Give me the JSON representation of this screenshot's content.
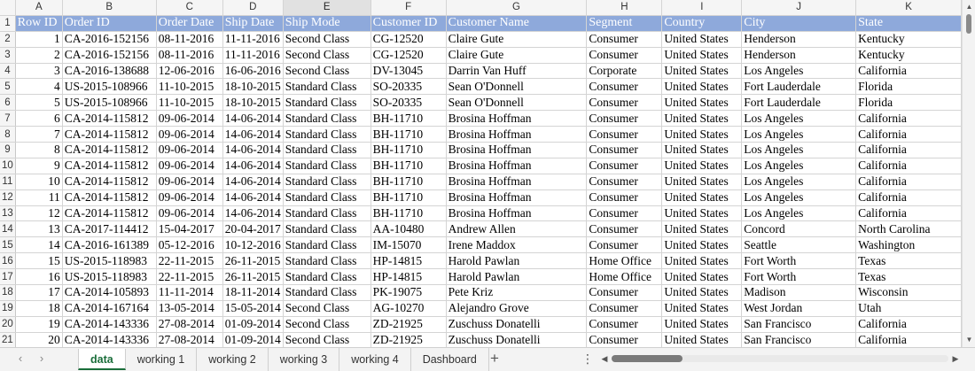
{
  "columns": [
    "A",
    "B",
    "C",
    "D",
    "E",
    "F",
    "G",
    "H",
    "I",
    "J",
    "K"
  ],
  "active_column": "E",
  "headers": [
    "Row ID",
    "Order ID",
    "Order Date",
    "Ship Date",
    "Ship Mode",
    "Customer ID",
    "Customer Name",
    "Segment",
    "Country",
    "City",
    "State"
  ],
  "rows": [
    [
      "1",
      "CA-2016-152156",
      "08-11-2016",
      "11-11-2016",
      "Second Class",
      "CG-12520",
      "Claire Gute",
      "Consumer",
      "United States",
      "Henderson",
      "Kentucky"
    ],
    [
      "2",
      "CA-2016-152156",
      "08-11-2016",
      "11-11-2016",
      "Second Class",
      "CG-12520",
      "Claire Gute",
      "Consumer",
      "United States",
      "Henderson",
      "Kentucky"
    ],
    [
      "3",
      "CA-2016-138688",
      "12-06-2016",
      "16-06-2016",
      "Second Class",
      "DV-13045",
      "Darrin Van Huff",
      "Corporate",
      "United States",
      "Los Angeles",
      "California"
    ],
    [
      "4",
      "US-2015-108966",
      "11-10-2015",
      "18-10-2015",
      "Standard Class",
      "SO-20335",
      "Sean O'Donnell",
      "Consumer",
      "United States",
      "Fort Lauderdale",
      "Florida"
    ],
    [
      "5",
      "US-2015-108966",
      "11-10-2015",
      "18-10-2015",
      "Standard Class",
      "SO-20335",
      "Sean O'Donnell",
      "Consumer",
      "United States",
      "Fort Lauderdale",
      "Florida"
    ],
    [
      "6",
      "CA-2014-115812",
      "09-06-2014",
      "14-06-2014",
      "Standard Class",
      "BH-11710",
      "Brosina Hoffman",
      "Consumer",
      "United States",
      "Los Angeles",
      "California"
    ],
    [
      "7",
      "CA-2014-115812",
      "09-06-2014",
      "14-06-2014",
      "Standard Class",
      "BH-11710",
      "Brosina Hoffman",
      "Consumer",
      "United States",
      "Los Angeles",
      "California"
    ],
    [
      "8",
      "CA-2014-115812",
      "09-06-2014",
      "14-06-2014",
      "Standard Class",
      "BH-11710",
      "Brosina Hoffman",
      "Consumer",
      "United States",
      "Los Angeles",
      "California"
    ],
    [
      "9",
      "CA-2014-115812",
      "09-06-2014",
      "14-06-2014",
      "Standard Class",
      "BH-11710",
      "Brosina Hoffman",
      "Consumer",
      "United States",
      "Los Angeles",
      "California"
    ],
    [
      "10",
      "CA-2014-115812",
      "09-06-2014",
      "14-06-2014",
      "Standard Class",
      "BH-11710",
      "Brosina Hoffman",
      "Consumer",
      "United States",
      "Los Angeles",
      "California"
    ],
    [
      "11",
      "CA-2014-115812",
      "09-06-2014",
      "14-06-2014",
      "Standard Class",
      "BH-11710",
      "Brosina Hoffman",
      "Consumer",
      "United States",
      "Los Angeles",
      "California"
    ],
    [
      "12",
      "CA-2014-115812",
      "09-06-2014",
      "14-06-2014",
      "Standard Class",
      "BH-11710",
      "Brosina Hoffman",
      "Consumer",
      "United States",
      "Los Angeles",
      "California"
    ],
    [
      "13",
      "CA-2017-114412",
      "15-04-2017",
      "20-04-2017",
      "Standard Class",
      "AA-10480",
      "Andrew Allen",
      "Consumer",
      "United States",
      "Concord",
      "North Carolina"
    ],
    [
      "14",
      "CA-2016-161389",
      "05-12-2016",
      "10-12-2016",
      "Standard Class",
      "IM-15070",
      "Irene Maddox",
      "Consumer",
      "United States",
      "Seattle",
      "Washington"
    ],
    [
      "15",
      "US-2015-118983",
      "22-11-2015",
      "26-11-2015",
      "Standard Class",
      "HP-14815",
      "Harold Pawlan",
      "Home Office",
      "United States",
      "Fort Worth",
      "Texas"
    ],
    [
      "16",
      "US-2015-118983",
      "22-11-2015",
      "26-11-2015",
      "Standard Class",
      "HP-14815",
      "Harold Pawlan",
      "Home Office",
      "United States",
      "Fort Worth",
      "Texas"
    ],
    [
      "17",
      "CA-2014-105893",
      "11-11-2014",
      "18-11-2014",
      "Standard Class",
      "PK-19075",
      "Pete Kriz",
      "Consumer",
      "United States",
      "Madison",
      "Wisconsin"
    ],
    [
      "18",
      "CA-2014-167164",
      "13-05-2014",
      "15-05-2014",
      "Second Class",
      "AG-10270",
      "Alejandro Grove",
      "Consumer",
      "United States",
      "West Jordan",
      "Utah"
    ],
    [
      "19",
      "CA-2014-143336",
      "27-08-2014",
      "01-09-2014",
      "Second Class",
      "ZD-21925",
      "Zuschuss Donatelli",
      "Consumer",
      "United States",
      "San Francisco",
      "California"
    ],
    [
      "20",
      "CA-2014-143336",
      "27-08-2014",
      "01-09-2014",
      "Second Class",
      "ZD-21925",
      "Zuschuss Donatelli",
      "Consumer",
      "United States",
      "San Francisco",
      "California"
    ]
  ],
  "tabs": [
    "data",
    "working 1",
    "working 2",
    "working 3",
    "working 4",
    "Dashboard"
  ],
  "active_tab": "data",
  "colors": {
    "header_fill": "#8ea9db",
    "header_text": "#ffffff",
    "active_tab": "#1a6e3a"
  }
}
